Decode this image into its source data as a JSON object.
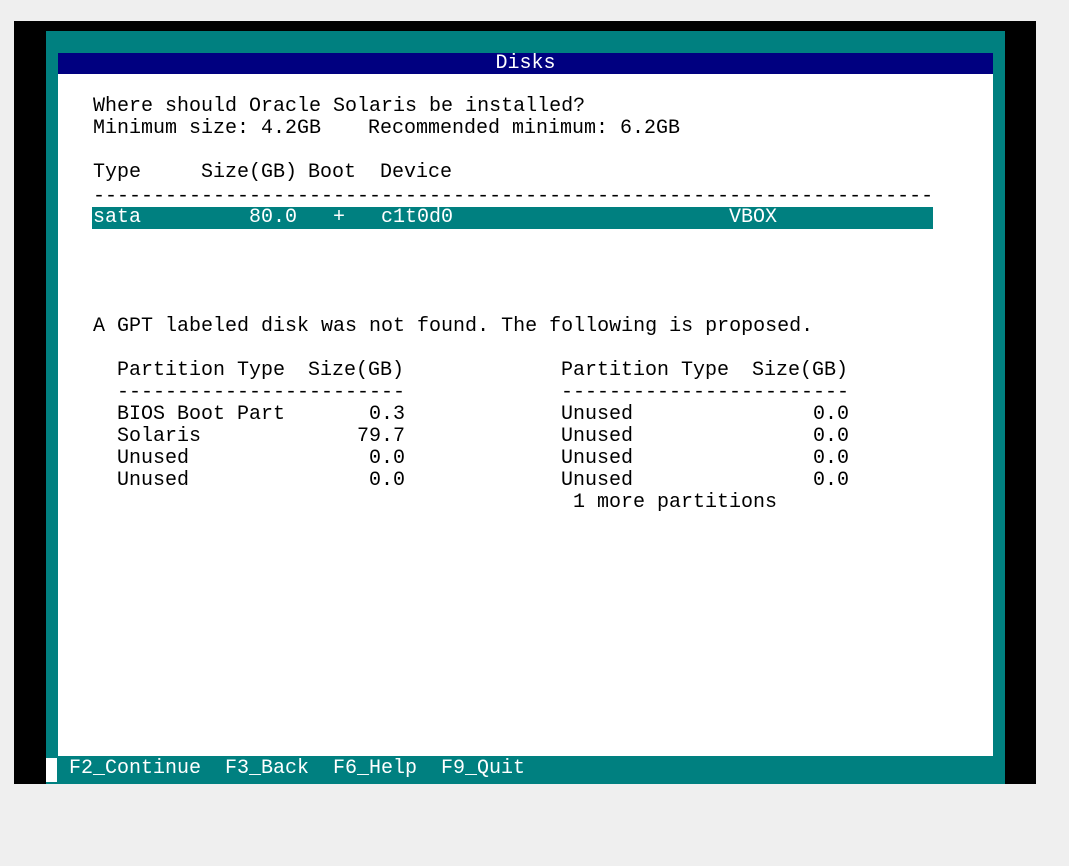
{
  "window": {
    "title": "Disks"
  },
  "intro": {
    "question": "Where should Oracle Solaris be installed?",
    "min_size": "Minimum size: 4.2GB",
    "recommended": "Recommended minimum: 6.2GB"
  },
  "disk_table": {
    "headers": [
      "Type",
      "Size(GB)",
      "Boot",
      "Device"
    ],
    "rule": "----------------------------------------------------------------------",
    "rows": [
      {
        "type": "sata",
        "size": "80.0",
        "boot": "+",
        "device": "c1t0d0",
        "vendor": "VBOX",
        "selected": true
      }
    ]
  },
  "proposal": {
    "message": "A GPT labeled disk was not found. The following is proposed.",
    "left_table": {
      "header_type": "Partition Type",
      "header_size": "Size(GB)",
      "rule": "------------------------",
      "rows": [
        {
          "type": "BIOS Boot Part",
          "size": "0.3"
        },
        {
          "type": "Solaris",
          "size": "79.7"
        },
        {
          "type": "Unused",
          "size": "0.0"
        },
        {
          "type": "Unused",
          "size": "0.0"
        }
      ]
    },
    "right_table": {
      "header_type": "Partition Type",
      "header_size": "Size(GB)",
      "rule": "------------------------",
      "rows": [
        {
          "type": "Unused",
          "size": "0.0"
        },
        {
          "type": "Unused",
          "size": "0.0"
        },
        {
          "type": "Unused",
          "size": "0.0"
        },
        {
          "type": "Unused",
          "size": "0.0"
        }
      ],
      "more": "1 more partitions"
    }
  },
  "footer": {
    "keys": [
      "F2_Continue",
      "F3_Back",
      "F6_Help",
      "F9_Quit"
    ]
  },
  "colors": {
    "frame": "#008080",
    "title_bar": "#000080",
    "panel": "#ffffff",
    "highlight": "#008080"
  }
}
